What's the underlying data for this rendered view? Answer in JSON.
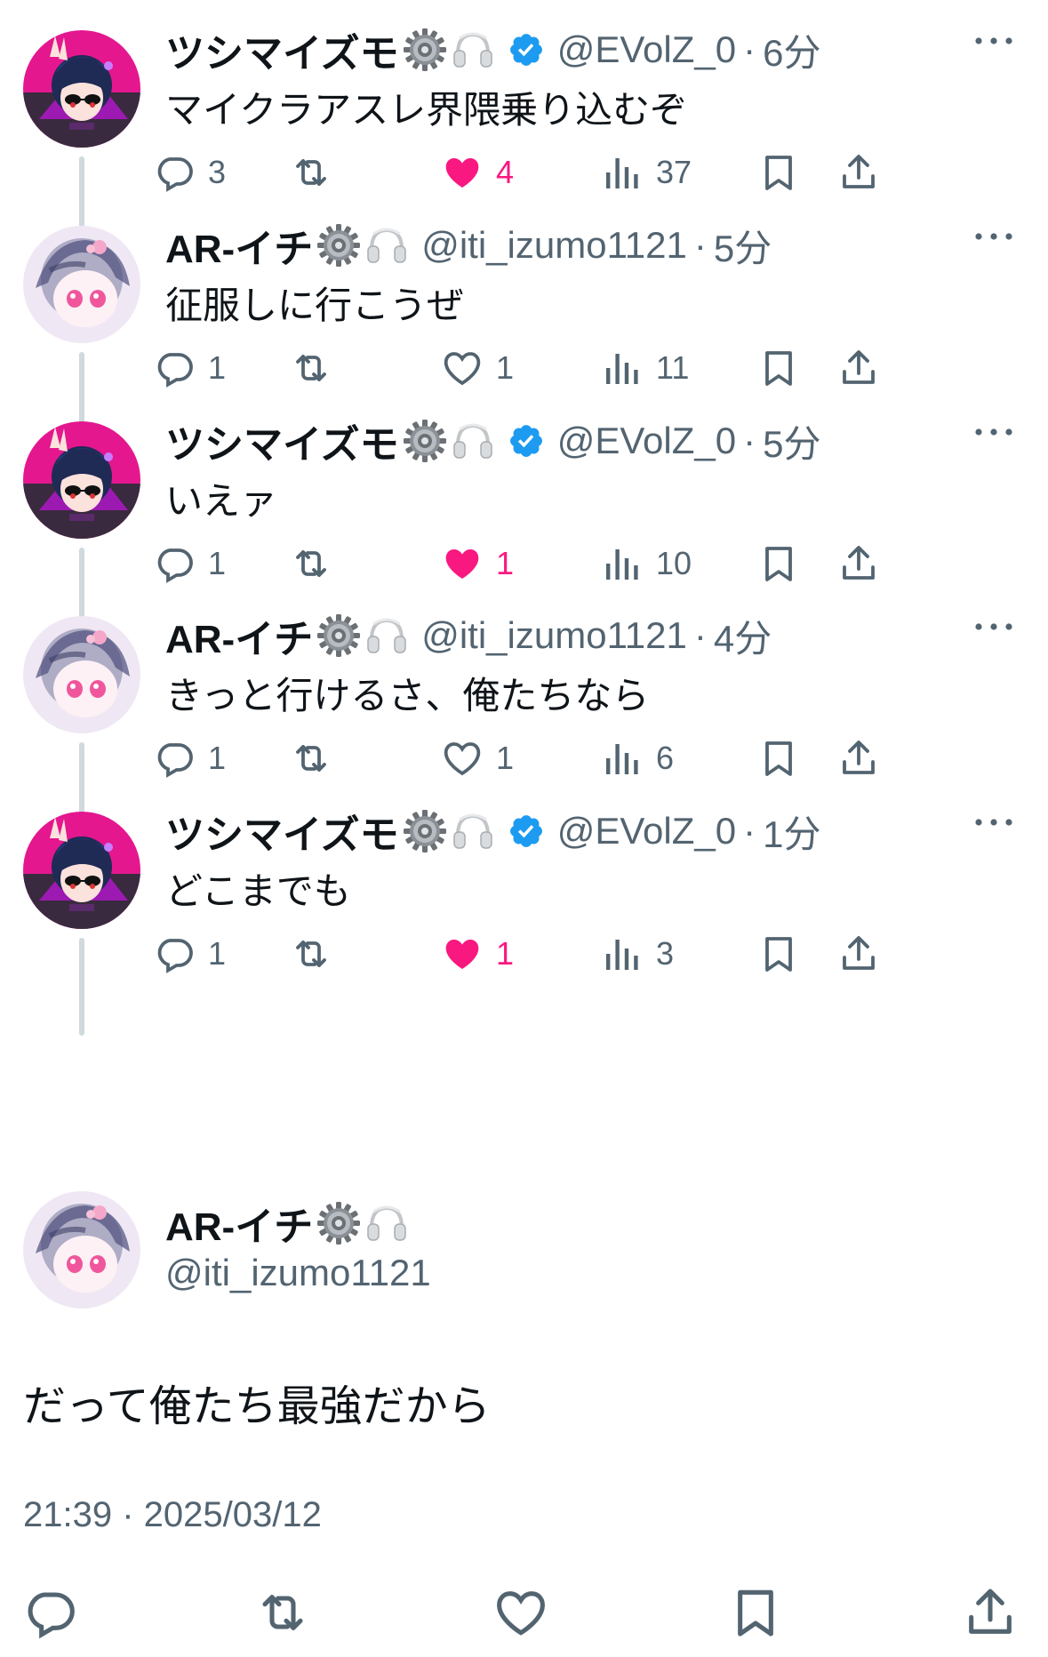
{
  "colors": {
    "text": "#0f1419",
    "secondary": "#536471",
    "like_pink": "#f91880",
    "verified_blue": "#1d9bf0",
    "thread_line": "#cfd9de"
  },
  "replies": [
    {
      "display_name": "ツシマイズモ",
      "badges": [
        "gear-emoji",
        "headphones-emoji"
      ],
      "verified": true,
      "handle": "@EVolZ_0",
      "separator": "·",
      "time": "6分",
      "text": "マイクラアスレ界隈乗り込むぞ",
      "reply_count": "3",
      "like_count": "4",
      "liked": true,
      "view_count": "37"
    },
    {
      "display_name": "AR-イチ",
      "badges": [
        "gear-emoji",
        "headphones-emoji"
      ],
      "verified": false,
      "handle": "@iti_izumo1121",
      "separator": "·",
      "time": "5分",
      "text": "征服しに行こうぜ",
      "reply_count": "1",
      "like_count": "1",
      "liked": false,
      "view_count": "11"
    },
    {
      "display_name": "ツシマイズモ",
      "badges": [
        "gear-emoji",
        "headphones-emoji"
      ],
      "verified": true,
      "handle": "@EVolZ_0",
      "separator": "·",
      "time": "5分",
      "text": "いえァ",
      "reply_count": "1",
      "like_count": "1",
      "liked": true,
      "view_count": "10"
    },
    {
      "display_name": "AR-イチ",
      "badges": [
        "gear-emoji",
        "headphones-emoji"
      ],
      "verified": false,
      "handle": "@iti_izumo1121",
      "separator": "·",
      "time": "4分",
      "text": "きっと行けるさ、俺たちなら",
      "reply_count": "1",
      "like_count": "1",
      "liked": false,
      "view_count": "6"
    },
    {
      "display_name": "ツシマイズモ",
      "badges": [
        "gear-emoji",
        "headphones-emoji"
      ],
      "verified": true,
      "handle": "@EVolZ_0",
      "separator": "·",
      "time": "1分",
      "text": "どこまでも",
      "reply_count": "1",
      "like_count": "1",
      "liked": true,
      "view_count": "3"
    }
  ],
  "main_post": {
    "display_name": "AR-イチ",
    "badges": [
      "gear-emoji",
      "headphones-emoji"
    ],
    "handle": "@iti_izumo1121",
    "text": "だって俺たち最強だから",
    "timestamp": "21:39 · 2025/03/12",
    "actions": [
      "reply-icon",
      "retweet-icon",
      "like-icon",
      "bookmark-icon",
      "share-icon"
    ]
  }
}
